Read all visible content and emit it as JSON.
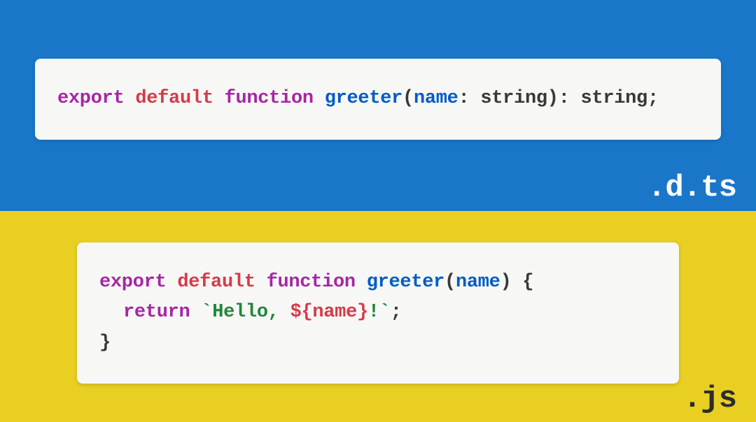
{
  "panels": {
    "top": {
      "label": ".d.ts",
      "bgColor": "#1a76c9",
      "code": {
        "tokens_line1": {
          "export": "export",
          "default": "default",
          "function": "function",
          "fnName": "greeter",
          "openParen": "(",
          "paramName": "name",
          "colon1": ": ",
          "paramType": "string",
          "closeParen": ")",
          "colon2": ": ",
          "returnType": "string",
          "semicolon": ";"
        }
      }
    },
    "bottom": {
      "label": ".js",
      "bgColor": "#e8cf22",
      "code": {
        "line1": {
          "export": "export",
          "default": "default",
          "function": "function",
          "fnName": "greeter",
          "openParen": "(",
          "paramName": "name",
          "closeParenBrace": ") {"
        },
        "line2": {
          "return": "return",
          "backtick1": " `",
          "strPart1": "Hello, ",
          "interpOpen": "${",
          "interpVar": "name",
          "interpClose": "}",
          "strPart2": "!",
          "backtick2": "`",
          "semicolon": ";"
        },
        "line3": {
          "closeBrace": "}"
        }
      }
    }
  },
  "colors": {
    "keywordPurple": "#a626a4",
    "keywordRed": "#d73a49",
    "functionBlue": "#005cc5",
    "stringGreen": "#22863a",
    "punct": "#383838"
  }
}
